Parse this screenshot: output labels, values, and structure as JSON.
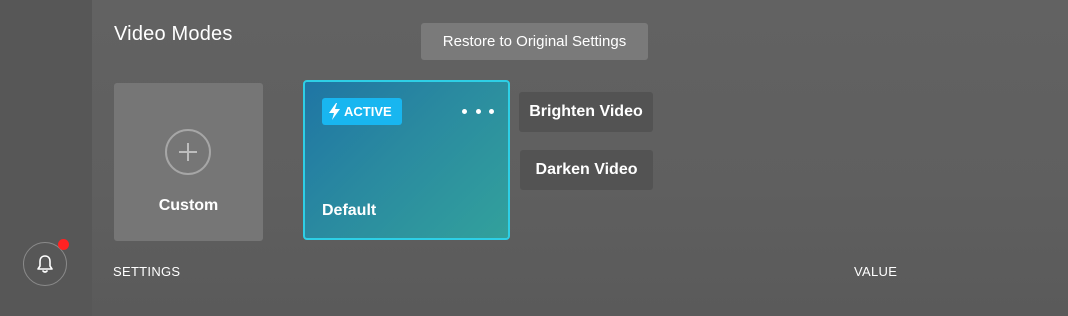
{
  "header": {
    "title": "Video Modes",
    "restore_label": "Restore to Original Settings"
  },
  "modes": {
    "custom_label": "Custom",
    "default_label": "Default",
    "active_badge": "ACTIVE"
  },
  "presets": {
    "brighten_label": "Brighten Video",
    "darken_label": "Darken Video"
  },
  "table": {
    "columns": [
      "SETTINGS",
      "VALUE"
    ]
  },
  "notifications": {
    "has_unread": true
  },
  "colors": {
    "accent": "#18b6f0",
    "active_border": "#2ecfe6",
    "notification": "#ff2222"
  },
  "icons": [
    "plus-icon",
    "bolt-icon",
    "more-options-icon",
    "bell-icon"
  ]
}
